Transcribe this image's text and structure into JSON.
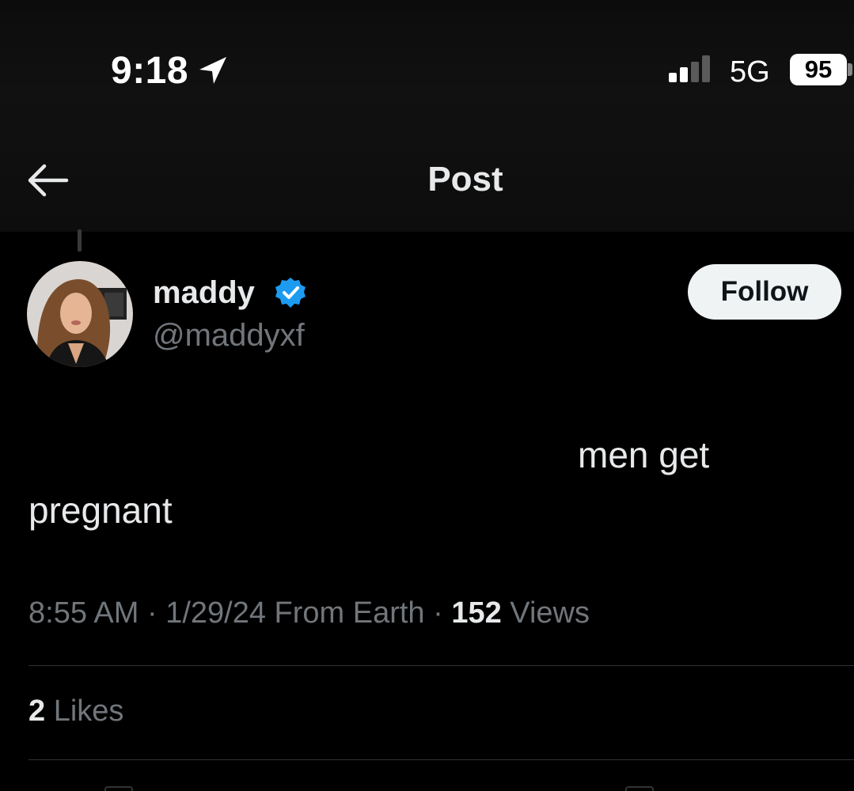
{
  "status_bar": {
    "time": "9:18",
    "network": "5G",
    "battery": "95"
  },
  "nav": {
    "title": "Post"
  },
  "post": {
    "author": {
      "name": "maddy",
      "handle": "@maddyxf",
      "verified": true
    },
    "follow_label": "Follow",
    "text_line1": "men get",
    "text_line2": "pregnant",
    "meta_prefix": "8:55 AM · 1/29/24 From Earth · ",
    "views_count": "152",
    "views_label": " Views",
    "likes_count": "2",
    "likes_label": " Likes"
  },
  "colors": {
    "background": "#000000",
    "primary_text": "#e7e9ea",
    "secondary_text": "#71767b",
    "verified_badge": "#1d9bf0",
    "follow_button_bg": "#eff3f4"
  },
  "icons": {
    "back": "arrow-left-icon",
    "location": "location-arrow-icon",
    "signal": "cellular-signal-icon",
    "verified": "verified-badge-icon"
  }
}
